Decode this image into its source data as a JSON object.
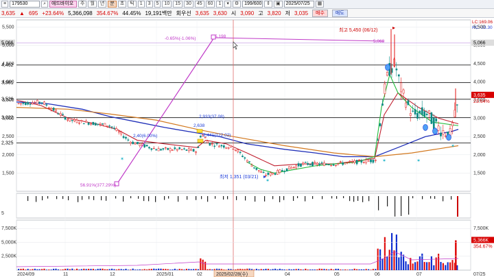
{
  "toolbar": {
    "menu_icon": "hamburger-icon",
    "stock_code": "179530",
    "stock_name": "애드바이오",
    "periods": [
      "주",
      "월",
      "년",
      "분",
      "초",
      "틱"
    ],
    "minutes": [
      "1",
      "3",
      "5",
      "10",
      "15",
      "30",
      "45",
      "60",
      "1"
    ],
    "count": "199/600",
    "date": "2025/07/25"
  },
  "quote": {
    "price": "3,635",
    "change": "695",
    "change_pct": "+23.64%",
    "amount": "5,366,098",
    "turnover": "354.67%",
    "ratio": "44.45%",
    "value": "19,191백만",
    "label_round": "회우선",
    "p1": "3,635",
    "p2": "3,630",
    "open_label": "시",
    "open": "3,090",
    "high_label": "고",
    "high": "3,820",
    "low_label": "저",
    "low": "3,035",
    "buy": "매수",
    "sell": "매도"
  },
  "right_info": {
    "lc": "LC:169.06",
    "hc": "HC:-33.30"
  },
  "price_axis": [
    "5,500",
    "5,000",
    "4,500",
    "4,000",
    "3,500",
    "3,000",
    "2,500",
    "2,000",
    "1,500"
  ],
  "left_labels": [
    "5,066",
    "4,462",
    "3,981",
    "3,526",
    "3,022",
    "2,325"
  ],
  "right_labels": [
    "5,066",
    "3,635",
    "23.64%"
  ],
  "annotations": {
    "high": "최고 5,450 (06/12)",
    "low": "최저 1,351 (03/21)",
    "top_line": "-0.65%(-1.06%)",
    "top_val": "5,198",
    "bottom": "56.91%(377.29%)",
    "ann_0": "5,068",
    "ann_1": "2,933(37.08)",
    "ann_2": "2,441(122.02)",
    "ann_3": "2,638",
    "ann_4": "2,40(6.00%)"
  },
  "signal_axis": [
    "5"
  ],
  "volume_axis": [
    "7,500K",
    "5,000K",
    "2,500K"
  ],
  "volume_right": [
    "7,500K",
    "5,366K",
    "354.67%"
  ],
  "x_labels": [
    "2024/09",
    "11",
    "12",
    "2025/01",
    "02",
    "03",
    "04",
    "05",
    "06",
    "07",
    "07/25"
  ],
  "cursor_date": "2025/02/28(수)",
  "colors": {
    "up": "#e01010",
    "down": "#1030d0",
    "ma_blue": "#1f2fb8",
    "ma_orange": "#d2781e",
    "ma_red": "#c0202f",
    "ma_green": "#1fbb3a",
    "trend": "#c03ac8"
  }
}
